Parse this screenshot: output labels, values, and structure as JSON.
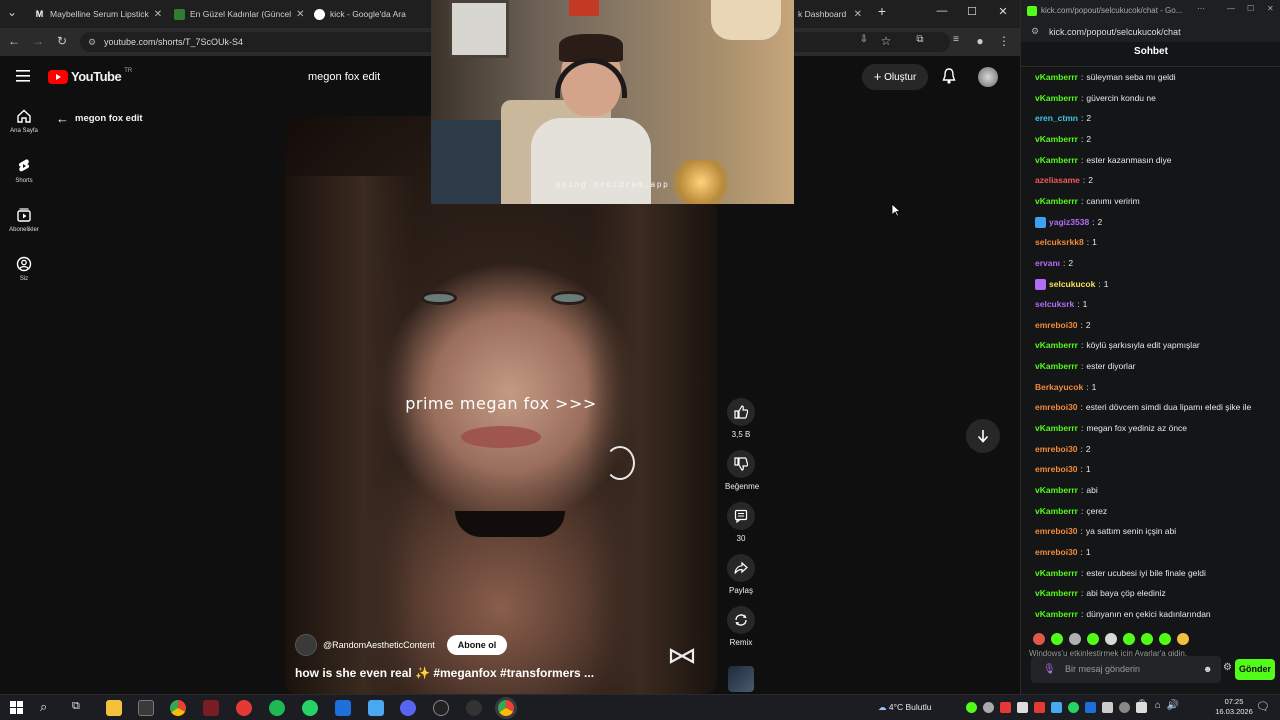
{
  "browser": {
    "tabs": [
      {
        "label": "Maybelline Serum Lipstick",
        "favicon_color": "#222222"
      },
      {
        "label": "En Güzel Kadınlar (Güncel",
        "favicon_color": "#2e7d32"
      },
      {
        "label": "kick - Google'da Ara",
        "favicon_color": "#4285f4"
      },
      {
        "label": "k Dashboard",
        "favicon_color": "#53fc18"
      }
    ],
    "url": "youtube.com/shorts/T_7ScOUk-S4"
  },
  "youtube": {
    "logo_text": "YouTube",
    "region": "TR",
    "search_value": "megon fox edit",
    "create_label": "Oluştur",
    "back_label": "megon fox edit",
    "sidebar": [
      {
        "label": "Ana Sayfa",
        "icon": "home-icon"
      },
      {
        "label": "Shorts",
        "icon": "shorts-icon"
      },
      {
        "label": "Abonelikler",
        "icon": "subscriptions-icon"
      },
      {
        "label": "Siz",
        "icon": "you-icon"
      }
    ],
    "video": {
      "overlay_text": "prime megan fox >>>",
      "channel": "@RandomAestheticContent",
      "subscribe_label": "Abone ol",
      "caption": "how is she even real ✨ #meganfox #transformers ..."
    },
    "actions": {
      "likes": "3,5 B",
      "dislike_label": "Beğenme",
      "comments": "30",
      "share_label": "Paylaş",
      "remix_label": "Remix"
    }
  },
  "webcam": {
    "watermark": "using droidcam.app"
  },
  "chat": {
    "window_url": "kick.com/popout/selcukucok/chat - Go...",
    "url": "kick.com/popout/selcukucok/chat",
    "heading": "Sohbet",
    "messages": [
      {
        "user": "vKamberrr",
        "color": "#53fc18",
        "text": "süleyman seba mı geldi"
      },
      {
        "user": "vKamberrr",
        "color": "#53fc18",
        "text": "güvercin kondu ne"
      },
      {
        "user": "eren_ctmn",
        "color": "#3ec6e8",
        "text": "2"
      },
      {
        "user": "vKamberrr",
        "color": "#53fc18",
        "text": "2"
      },
      {
        "user": "vKamberrr",
        "color": "#53fc18",
        "text": "ester kazanmasın diye"
      },
      {
        "user": "azeliasame",
        "color": "#f05a5a",
        "text": "2"
      },
      {
        "user": "vKamberrr",
        "color": "#53fc18",
        "text": "canımı veririm"
      },
      {
        "user": "yagiz3538",
        "color": "#b26df7",
        "text": "2",
        "badge": "#3ea0f0"
      },
      {
        "user": "selcuksrkk8",
        "color": "#f08a3c",
        "text": "1"
      },
      {
        "user": "ervanı",
        "color": "#b26df7",
        "text": "2"
      },
      {
        "user": "selcukucok",
        "color": "#f5e15a",
        "text": "1",
        "badge": "#b26df7"
      },
      {
        "user": "selcuksrk",
        "color": "#b26df7",
        "text": "1"
      },
      {
        "user": "emreboi30",
        "color": "#f08a3c",
        "text": "2"
      },
      {
        "user": "vKamberrr",
        "color": "#53fc18",
        "text": "köylü şarkısıyla edit yapmışlar"
      },
      {
        "user": "vKamberrr",
        "color": "#53fc18",
        "text": "ester diyorlar"
      },
      {
        "user": "Berkayucok",
        "color": "#f08a3c",
        "text": "1"
      },
      {
        "user": "emreboi30",
        "color": "#f08a3c",
        "text": "esteri dövcem simdi dua lipamı eledi şike ile"
      },
      {
        "user": "vKamberrr",
        "color": "#53fc18",
        "text": "megan fox yediniz az önce"
      },
      {
        "user": "emreboi30",
        "color": "#f08a3c",
        "text": "2"
      },
      {
        "user": "emreboi30",
        "color": "#f08a3c",
        "text": "1"
      },
      {
        "user": "vKamberrr",
        "color": "#53fc18",
        "text": "abi"
      },
      {
        "user": "vKamberrr",
        "color": "#53fc18",
        "text": "çerez"
      },
      {
        "user": "emreboi30",
        "color": "#f08a3c",
        "text": "ya sattım senin içşin abi"
      },
      {
        "user": "emreboi30",
        "color": "#f08a3c",
        "text": "1"
      },
      {
        "user": "vKamberrr",
        "color": "#53fc18",
        "text": "ester ucubesi iyi bile finale geldi"
      },
      {
        "user": "vKamberrr",
        "color": "#53fc18",
        "text": "abi baya çöp elediniz"
      },
      {
        "user": "vKamberrr",
        "color": "#53fc18",
        "text": "dünyanın en çekici kadınlarından"
      }
    ],
    "windows_activate": "Windows'u etkinleştirmek için Ayarlar'a gidin.",
    "input_placeholder": "Bir mesaj gönderin",
    "send_label": "Gönder",
    "accent": "#53fc18"
  },
  "taskbar": {
    "weather": "4°C  Bulutlu",
    "time": "07:25",
    "date": "16.03.2026"
  }
}
